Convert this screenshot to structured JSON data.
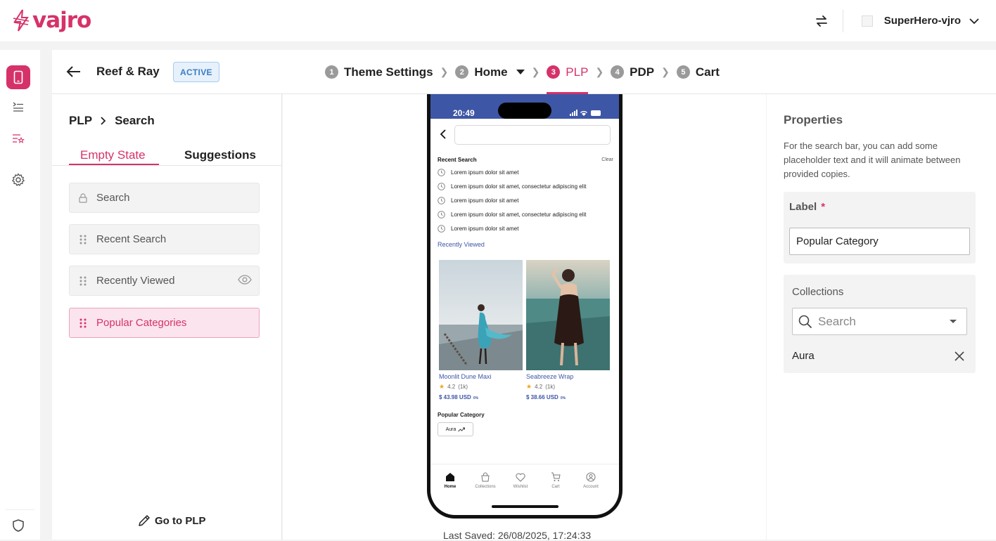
{
  "app": {
    "name": "vajro",
    "store_name": "SuperHero-vjro",
    "brand_color": "#d6326a"
  },
  "header": {
    "store": "Reef & Ray",
    "status_badge": "ACTIVE",
    "steps": [
      {
        "num": "1",
        "label": "Theme Settings"
      },
      {
        "num": "2",
        "label": "Home"
      },
      {
        "num": "3",
        "label": "PLP"
      },
      {
        "num": "4",
        "label": "PDP"
      },
      {
        "num": "5",
        "label": "Cart"
      }
    ]
  },
  "left": {
    "breadcrumb": [
      "PLP",
      "Search"
    ],
    "tabs": {
      "empty": "Empty State",
      "suggestions": "Suggestions"
    },
    "items": [
      "Search",
      "Recent Search",
      "Recently Viewed",
      "Popular Categories"
    ],
    "goto": "Go to PLP"
  },
  "phone": {
    "time": "20:49",
    "recent_title": "Recent Search",
    "clear": "Clear",
    "recent": [
      "Lorem ipsum dolor sit amet",
      "Lorem ipsum dolor sit amet, consectetur adipiscing elit",
      "Lorem ipsum dolor sit amet",
      "Lorem ipsum dolor sit amet, consectetur adipiscing elit",
      "Lorem ipsum dolor sit amet"
    ],
    "recently_viewed": "Recently Viewed",
    "products": [
      {
        "name": "Moonlit Dune Maxi",
        "rating": "4.2",
        "count": "(1k)",
        "price": "$ 43.98 USD",
        "off": "0%"
      },
      {
        "name": "Seabreeze Wrap",
        "rating": "4.2",
        "count": "(1k)",
        "price": "$ 38.66 USD",
        "off": "0%"
      }
    ],
    "popular_title": "Popular Category",
    "chip": "Aura",
    "tabbar": [
      "Home",
      "Collections",
      "Wishlist",
      "Cart",
      "Account"
    ]
  },
  "last_saved": "Last Saved:  26/08/2025, 17:24:33",
  "right": {
    "title": "Properties",
    "desc": "For the search bar, you can add some placeholder text and it will animate between provided copies.",
    "label_title": "Label",
    "label_required": "*",
    "label_value": "Popular Category",
    "collections_title": "Collections",
    "search_placeholder": "Search",
    "collection_item": "Aura"
  }
}
